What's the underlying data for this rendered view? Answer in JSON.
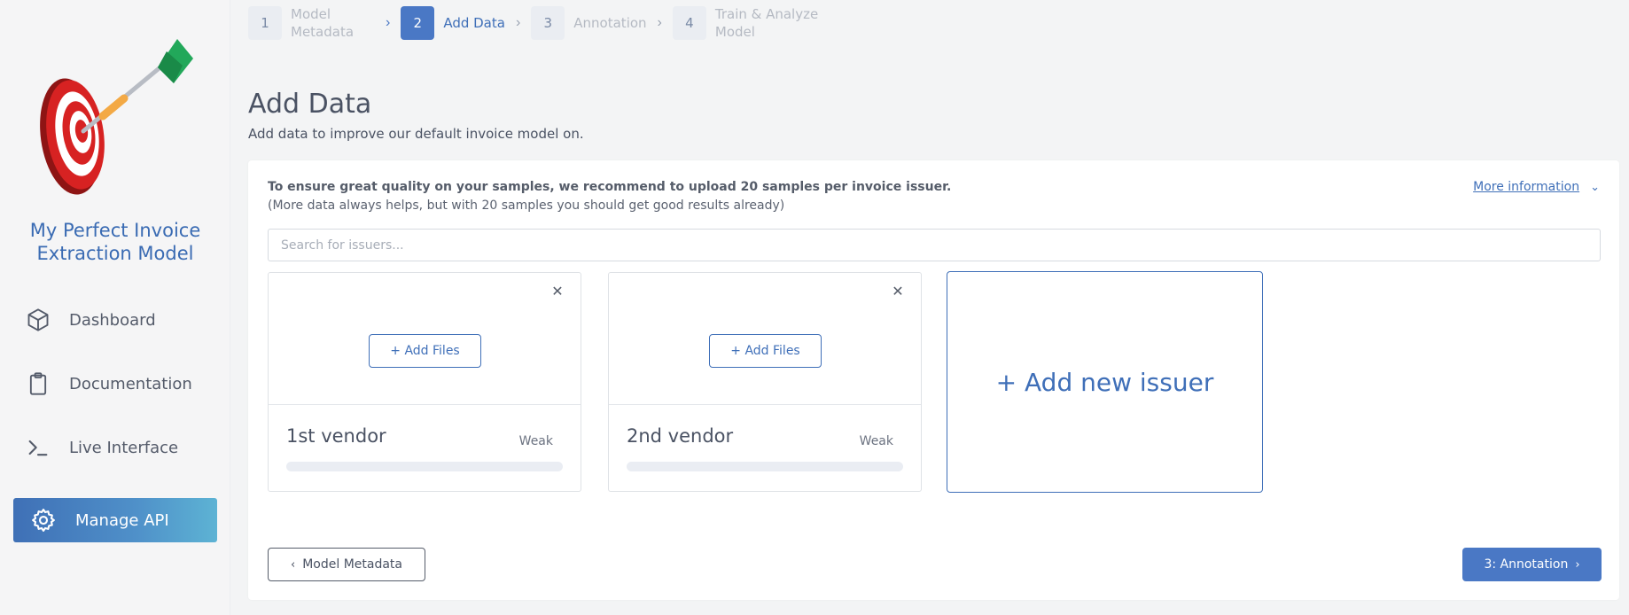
{
  "app": {
    "title": "My Perfect Invoice Extraction Model"
  },
  "sidebar": {
    "items": [
      {
        "label": "Dashboard",
        "icon": "cube-icon"
      },
      {
        "label": "Documentation",
        "icon": "clipboard-icon"
      },
      {
        "label": "Live Interface",
        "icon": "terminal-icon"
      },
      {
        "label": "Manage API",
        "icon": "gear-icon",
        "active": true
      }
    ]
  },
  "stepper": {
    "steps": [
      {
        "num": "1",
        "label": "Model Metadata"
      },
      {
        "num": "2",
        "label": "Add Data",
        "active": true
      },
      {
        "num": "3",
        "label": "Annotation"
      },
      {
        "num": "4",
        "label": "Train & Analyze Model"
      }
    ]
  },
  "page": {
    "title": "Add Data",
    "subtitle": "Add data to improve our default invoice model on."
  },
  "info": {
    "recommendation": "To ensure great quality on your samples, we recommend to upload 20 samples per invoice issuer.",
    "note": "(More data always helps, but with 20 samples you should get good results already)",
    "more_link": "More information"
  },
  "search": {
    "placeholder": "Search for issuers..."
  },
  "issuers": [
    {
      "name": "1st vendor",
      "strength": "Weak",
      "add_files_label": "+ Add Files",
      "progress": 0
    },
    {
      "name": "2nd vendor",
      "strength": "Weak",
      "add_files_label": "+ Add Files",
      "progress": 0
    }
  ],
  "add_issuer_label": "+ Add new issuer",
  "footer": {
    "back_label": "Model Metadata",
    "next_label": "3: Annotation"
  },
  "colors": {
    "accent": "#4a78c5",
    "link": "#3f6fb8",
    "title": "#3a6bb3"
  }
}
